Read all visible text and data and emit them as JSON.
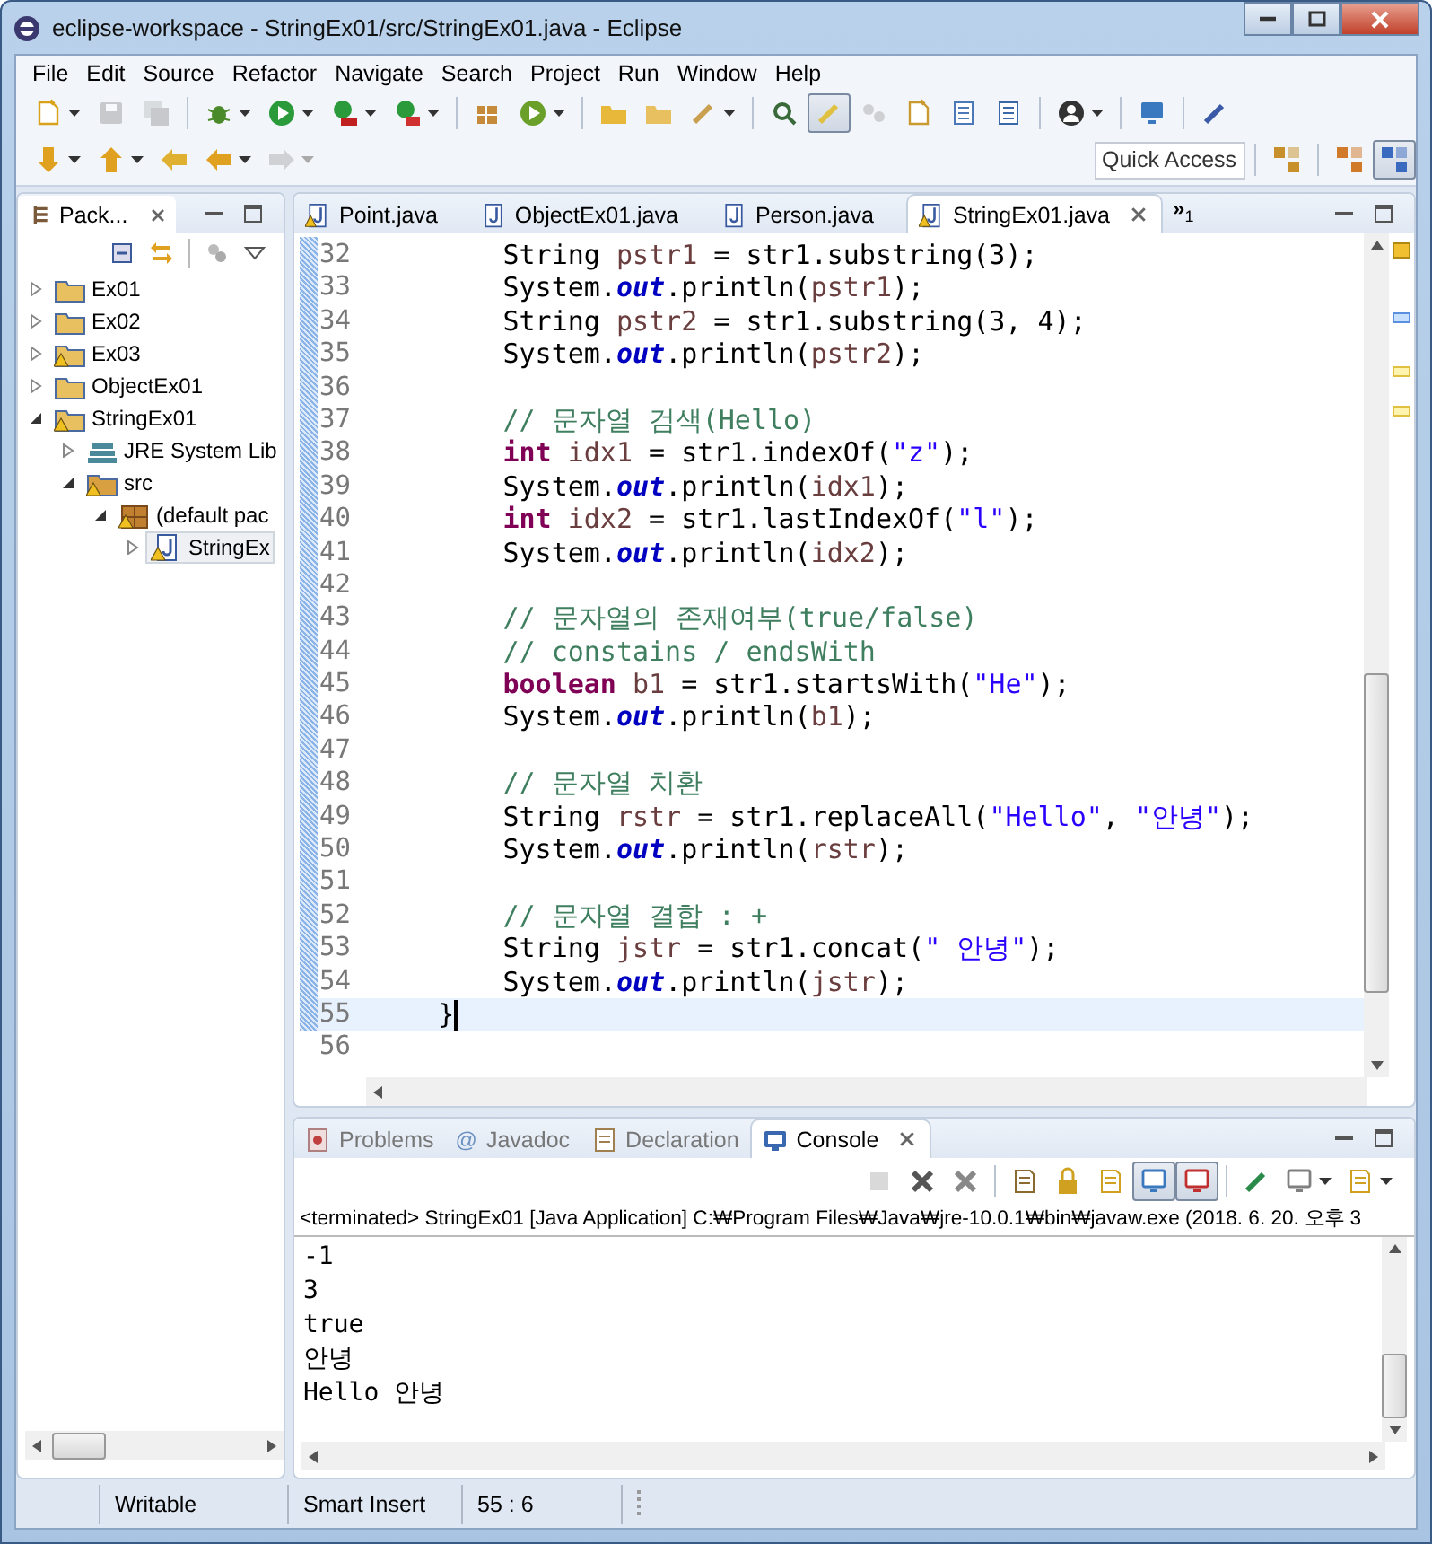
{
  "window": {
    "title": "eclipse-workspace - StringEx01/src/StringEx01.java - Eclipse"
  },
  "menu": [
    "File",
    "Edit",
    "Source",
    "Refactor",
    "Navigate",
    "Search",
    "Project",
    "Run",
    "Window",
    "Help"
  ],
  "toolbar_main": [
    {
      "pressed": false,
      "disabled": false
    },
    {
      "pressed": false,
      "disabled": true
    },
    {
      "pressed": false,
      "disabled": true
    },
    {
      "pressed": false,
      "disabled": false
    },
    {
      "pressed": false,
      "disabled": false
    },
    {
      "pressed": false,
      "disabled": false
    },
    {
      "pressed": false,
      "disabled": false
    },
    {
      "pressed": false,
      "disabled": false
    },
    {
      "pressed": false,
      "disabled": false
    },
    {
      "pressed": false,
      "disabled": false
    },
    {
      "pressed": false,
      "disabled": false
    },
    {
      "pressed": false,
      "disabled": false
    },
    {
      "pressed": false,
      "disabled": false
    },
    {
      "pressed": true,
      "disabled": false
    },
    {
      "pressed": false,
      "disabled": true
    },
    {
      "pressed": false,
      "disabled": false
    },
    {
      "pressed": false,
      "disabled": false
    },
    {
      "pressed": false,
      "disabled": false
    },
    {
      "pressed": false,
      "disabled": false
    },
    {
      "pressed": false,
      "disabled": false
    },
    {
      "pressed": false,
      "disabled": false
    }
  ],
  "toolbar_nav": [
    {
      "pressed": false,
      "disabled": false
    },
    {
      "pressed": false,
      "disabled": false
    },
    {
      "pressed": false,
      "disabled": false
    },
    {
      "pressed": false,
      "disabled": false
    },
    {
      "pressed": false,
      "disabled": true
    }
  ],
  "quick_access": {
    "placeholder": "Quick Access"
  },
  "perspectives": [
    {
      "selected": false
    },
    {
      "selected": false
    },
    {
      "selected": true
    }
  ],
  "package_explorer": {
    "title": "Pack...",
    "tree": [
      {
        "label": "Ex01",
        "kind": "project",
        "warning": false,
        "expanded": false,
        "selected": false
      },
      {
        "label": "Ex02",
        "kind": "project",
        "warning": false,
        "expanded": false,
        "selected": false
      },
      {
        "label": "Ex03",
        "kind": "project",
        "warning": true,
        "expanded": false,
        "selected": false
      },
      {
        "label": "ObjectEx01",
        "kind": "project",
        "warning": false,
        "expanded": false,
        "selected": false
      },
      {
        "label": "StringEx01",
        "kind": "project",
        "warning": true,
        "expanded": true,
        "selected": false,
        "children": [
          {
            "label": "JRE System Lib",
            "kind": "library",
            "warning": false,
            "expanded": false,
            "selected": false
          },
          {
            "label": "src",
            "kind": "sourcefolder",
            "warning": true,
            "expanded": true,
            "selected": false,
            "children": [
              {
                "label": "(default pac",
                "kind": "package",
                "warning": true,
                "expanded": true,
                "selected": false,
                "children": [
                  {
                    "label": "StringEx",
                    "kind": "javafile",
                    "warning": true,
                    "expanded": false,
                    "selected": true
                  }
                ]
              }
            ]
          }
        ]
      }
    ]
  },
  "editor": {
    "tabs": [
      {
        "label": "Point.java",
        "warning": true,
        "selected": false
      },
      {
        "label": "ObjectEx01.java",
        "warning": false,
        "selected": false
      },
      {
        "label": "Person.java",
        "warning": false,
        "selected": false
      },
      {
        "label": "StringEx01.java",
        "warning": true,
        "selected": true
      }
    ],
    "overflow": {
      "symbol": "»",
      "count": "1"
    },
    "lines": [
      {
        "number": "32",
        "current": false,
        "tokens": [
          {
            "kind": "plain",
            "text": "        String "
          },
          {
            "kind": "var",
            "text": "pstr1"
          },
          {
            "kind": "plain",
            "text": " = str1.substring(3);"
          }
        ]
      },
      {
        "number": "33",
        "current": false,
        "tokens": [
          {
            "kind": "plain",
            "text": "        System."
          },
          {
            "kind": "field",
            "text": "out"
          },
          {
            "kind": "plain",
            "text": ".println("
          },
          {
            "kind": "var",
            "text": "pstr1"
          },
          {
            "kind": "plain",
            "text": ");"
          }
        ]
      },
      {
        "number": "34",
        "current": false,
        "tokens": [
          {
            "kind": "plain",
            "text": "        String "
          },
          {
            "kind": "var",
            "text": "pstr2"
          },
          {
            "kind": "plain",
            "text": " = str1.substring(3, 4);"
          }
        ]
      },
      {
        "number": "35",
        "current": false,
        "tokens": [
          {
            "kind": "plain",
            "text": "        System."
          },
          {
            "kind": "field",
            "text": "out"
          },
          {
            "kind": "plain",
            "text": ".println("
          },
          {
            "kind": "var",
            "text": "pstr2"
          },
          {
            "kind": "plain",
            "text": ");"
          }
        ]
      },
      {
        "number": "36",
        "current": false
      },
      {
        "number": "37",
        "current": false,
        "tokens": [
          {
            "kind": "comment",
            "text": "        // 문자열 검색(Hello)"
          }
        ]
      },
      {
        "number": "38",
        "current": false,
        "tokens": [
          {
            "kind": "keyword",
            "text": "        int "
          },
          {
            "kind": "var",
            "text": "idx1"
          },
          {
            "kind": "plain",
            "text": " = str1.indexOf("
          },
          {
            "kind": "string",
            "text": "\"z\""
          },
          {
            "kind": "plain",
            "text": ");"
          }
        ]
      },
      {
        "number": "39",
        "current": false,
        "tokens": [
          {
            "kind": "plain",
            "text": "        System."
          },
          {
            "kind": "field",
            "text": "out"
          },
          {
            "kind": "plain",
            "text": ".println("
          },
          {
            "kind": "var",
            "text": "idx1"
          },
          {
            "kind": "plain",
            "text": ");"
          }
        ]
      },
      {
        "number": "40",
        "current": false,
        "tokens": [
          {
            "kind": "keyword",
            "text": "        int "
          },
          {
            "kind": "var",
            "text": "idx2"
          },
          {
            "kind": "plain",
            "text": " = str1.lastIndexOf("
          },
          {
            "kind": "string",
            "text": "\"l\""
          },
          {
            "kind": "plain",
            "text": ");"
          }
        ]
      },
      {
        "number": "41",
        "current": false,
        "tokens": [
          {
            "kind": "plain",
            "text": "        System."
          },
          {
            "kind": "field",
            "text": "out"
          },
          {
            "kind": "plain",
            "text": ".println("
          },
          {
            "kind": "var",
            "text": "idx2"
          },
          {
            "kind": "plain",
            "text": ");"
          }
        ]
      },
      {
        "number": "42",
        "current": false
      },
      {
        "number": "43",
        "current": false,
        "tokens": [
          {
            "kind": "comment",
            "text": "        // 문자열의 존재여부(true/false)"
          }
        ]
      },
      {
        "number": "44",
        "current": false,
        "tokens": [
          {
            "kind": "comment",
            "text": "        // constains / endsWith"
          }
        ]
      },
      {
        "number": "45",
        "current": false,
        "tokens": [
          {
            "kind": "keyword",
            "text": "        boolean "
          },
          {
            "kind": "var",
            "text": "b1"
          },
          {
            "kind": "plain",
            "text": " = str1.startsWith("
          },
          {
            "kind": "string",
            "text": "\"He\""
          },
          {
            "kind": "plain",
            "text": ");"
          }
        ]
      },
      {
        "number": "46",
        "current": false,
        "tokens": [
          {
            "kind": "plain",
            "text": "        System."
          },
          {
            "kind": "field",
            "text": "out"
          },
          {
            "kind": "plain",
            "text": ".println("
          },
          {
            "kind": "var",
            "text": "b1"
          },
          {
            "kind": "plain",
            "text": ");"
          }
        ]
      },
      {
        "number": "47",
        "current": false
      },
      {
        "number": "48",
        "current": false,
        "tokens": [
          {
            "kind": "comment",
            "text": "        // 문자열 치환"
          }
        ]
      },
      {
        "number": "49",
        "current": false,
        "tokens": [
          {
            "kind": "plain",
            "text": "        String "
          },
          {
            "kind": "var",
            "text": "rstr"
          },
          {
            "kind": "plain",
            "text": " = str1.replaceAll("
          },
          {
            "kind": "string",
            "text": "\"Hello\""
          },
          {
            "kind": "plain",
            "text": ", "
          },
          {
            "kind": "string",
            "text": "\"안녕\""
          },
          {
            "kind": "plain",
            "text": ");"
          }
        ]
      },
      {
        "number": "50",
        "current": false,
        "tokens": [
          {
            "kind": "plain",
            "text": "        System."
          },
          {
            "kind": "field",
            "text": "out"
          },
          {
            "kind": "plain",
            "text": ".println("
          },
          {
            "kind": "var",
            "text": "rstr"
          },
          {
            "kind": "plain",
            "text": ");"
          }
        ]
      },
      {
        "number": "51",
        "current": false
      },
      {
        "number": "52",
        "current": false,
        "tokens": [
          {
            "kind": "comment",
            "text": "        // 문자열 결합 : +"
          }
        ]
      },
      {
        "number": "53",
        "current": false,
        "tokens": [
          {
            "kind": "plain",
            "text": "        String "
          },
          {
            "kind": "var",
            "text": "jstr"
          },
          {
            "kind": "plain",
            "text": " = str1.concat("
          },
          {
            "kind": "string",
            "text": "\" 안녕\""
          },
          {
            "kind": "plain",
            "text": ");"
          }
        ]
      },
      {
        "number": "54",
        "current": false,
        "tokens": [
          {
            "kind": "plain",
            "text": "        System."
          },
          {
            "kind": "field",
            "text": "out"
          },
          {
            "kind": "plain",
            "text": ".println("
          },
          {
            "kind": "var",
            "text": "jstr"
          },
          {
            "kind": "plain",
            "text": ");"
          }
        ]
      },
      {
        "number": "55",
        "current": true,
        "tokens": [
          {
            "kind": "plain",
            "text": "    }"
          }
        ]
      },
      {
        "number": "56",
        "current": false
      }
    ]
  },
  "bottom_panel": {
    "tabs": [
      {
        "label": "Problems",
        "kind": "problems",
        "selected": false
      },
      {
        "label": "Javadoc",
        "kind": "javadoc",
        "glyph": "@",
        "selected": false
      },
      {
        "label": "Declaration",
        "kind": "declaration",
        "selected": false
      },
      {
        "label": "Console",
        "kind": "console",
        "selected": true
      }
    ],
    "toolbar": [
      {
        "pressed": false,
        "disabled": true
      },
      {
        "pressed": false,
        "disabled": false
      },
      {
        "pressed": false,
        "disabled": false
      },
      {
        "pressed": false,
        "disabled": false
      },
      {
        "pressed": false,
        "disabled": false
      },
      {
        "pressed": false,
        "disabled": false
      },
      {
        "pressed": true,
        "disabled": false
      },
      {
        "pressed": true,
        "disabled": false
      },
      {
        "pressed": false,
        "disabled": false
      },
      {
        "pressed": false,
        "disabled": false
      },
      {
        "pressed": false,
        "disabled": false
      }
    ],
    "process": "<terminated> StringEx01 [Java Application] C:₩Program Files₩Java₩jre-10.0.1₩bin₩javaw.exe (2018. 6. 20. 오후 3",
    "output": [
      "-1",
      "3",
      "true",
      "안녕",
      "Hello 안녕"
    ]
  },
  "status_bar": [
    "Writable",
    "Smart Insert",
    "55 : 6"
  ]
}
